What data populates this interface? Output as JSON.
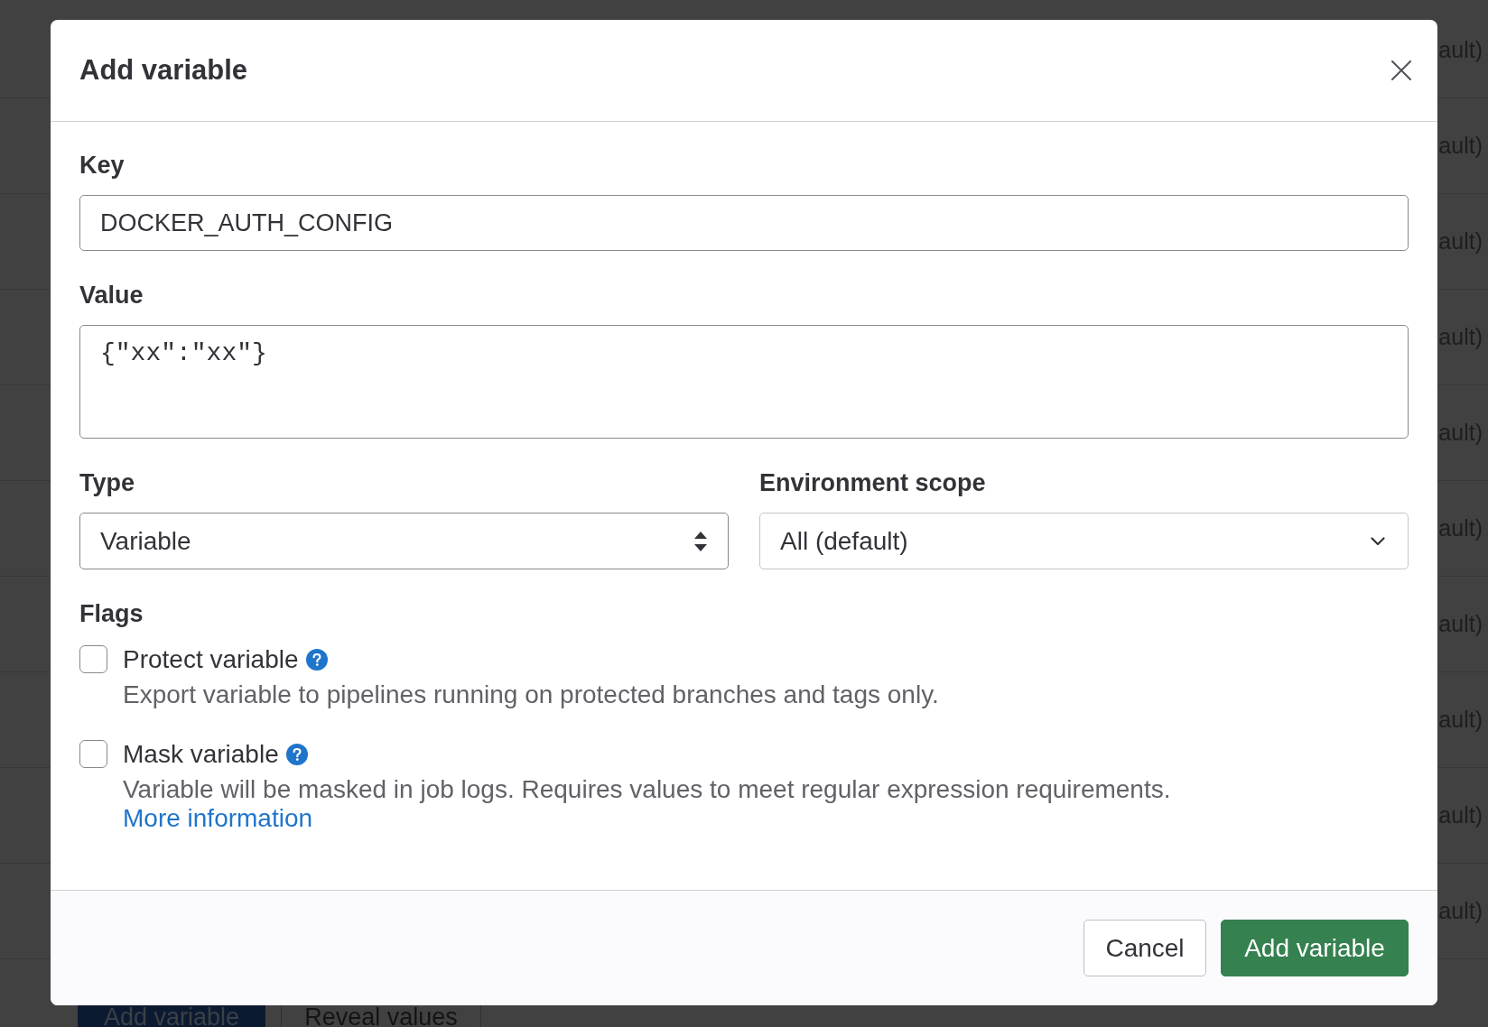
{
  "background": {
    "rows": [
      {
        "text": "ault)"
      },
      {
        "text": "ault)"
      },
      {
        "text": "ault)"
      },
      {
        "text": "ault)"
      },
      {
        "text": "ault)"
      },
      {
        "text": "ault)"
      },
      {
        "text": "ault)"
      },
      {
        "text": "ault)"
      },
      {
        "text": "ault)"
      },
      {
        "text": "ault)"
      }
    ],
    "buttons": [
      {
        "label": "Add variable",
        "kind": "primary"
      },
      {
        "label": "Reveal values",
        "kind": "default"
      }
    ]
  },
  "modal": {
    "title": "Add variable",
    "key": {
      "label": "Key",
      "value": "DOCKER_AUTH_CONFIG"
    },
    "value": {
      "label": "Value",
      "value": "{\"xx\":\"xx\"}"
    },
    "type": {
      "label": "Type",
      "value": "Variable"
    },
    "scope": {
      "label": "Environment scope",
      "value": "All (default)"
    },
    "flags": {
      "label": "Flags",
      "items": [
        {
          "label": "Protect variable",
          "checked": false,
          "help": "Export variable to pipelines running on protected branches and tags only."
        },
        {
          "label": "Mask variable",
          "checked": false,
          "help": "Variable will be masked in job logs. Requires values to meet regular expression requirements.",
          "link": "More information"
        }
      ]
    },
    "footer": {
      "buttons": [
        {
          "label": "Cancel",
          "kind": "secondary"
        },
        {
          "label": "Add variable",
          "kind": "primary"
        }
      ]
    }
  }
}
